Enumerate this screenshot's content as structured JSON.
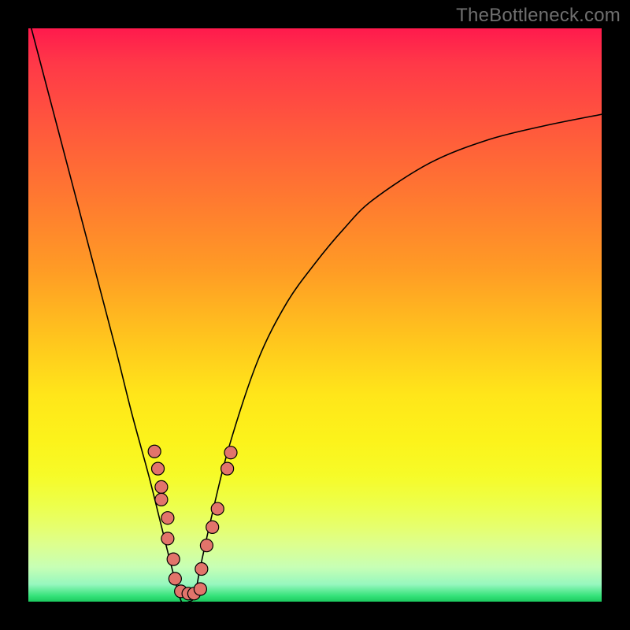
{
  "watermark": "TheBottleneck.com",
  "chart_data": {
    "type": "line",
    "title": "",
    "xlabel": "",
    "ylabel": "",
    "xlim": [
      0,
      1
    ],
    "ylim": [
      0,
      1
    ],
    "series": [
      {
        "name": "bottleneck-curve",
        "x": [
          0.0,
          0.05,
          0.1,
          0.15,
          0.18,
          0.21,
          0.23,
          0.25,
          0.267,
          0.28,
          0.29,
          0.3,
          0.32,
          0.35,
          0.4,
          0.45,
          0.5,
          0.55,
          0.6,
          0.7,
          0.8,
          0.9,
          1.0
        ],
        "y": [
          1.02,
          0.83,
          0.64,
          0.45,
          0.33,
          0.22,
          0.14,
          0.06,
          0.0,
          0.0,
          0.01,
          0.06,
          0.15,
          0.27,
          0.42,
          0.52,
          0.59,
          0.65,
          0.7,
          0.765,
          0.805,
          0.83,
          0.85
        ]
      }
    ],
    "markers": {
      "name": "data-point-markers",
      "points": [
        {
          "x": 0.22,
          "y": 0.262
        },
        {
          "x": 0.226,
          "y": 0.232
        },
        {
          "x": 0.232,
          "y": 0.2
        },
        {
          "x": 0.232,
          "y": 0.178
        },
        {
          "x": 0.243,
          "y": 0.146
        },
        {
          "x": 0.243,
          "y": 0.11
        },
        {
          "x": 0.253,
          "y": 0.074
        },
        {
          "x": 0.256,
          "y": 0.04
        },
        {
          "x": 0.266,
          "y": 0.018
        },
        {
          "x": 0.279,
          "y": 0.014
        },
        {
          "x": 0.289,
          "y": 0.014
        },
        {
          "x": 0.3,
          "y": 0.022
        },
        {
          "x": 0.302,
          "y": 0.057
        },
        {
          "x": 0.311,
          "y": 0.098
        },
        {
          "x": 0.321,
          "y": 0.13
        },
        {
          "x": 0.33,
          "y": 0.162
        },
        {
          "x": 0.347,
          "y": 0.232
        },
        {
          "x": 0.353,
          "y": 0.26
        }
      ],
      "radius_frac": 0.011,
      "fill": "#e2746b",
      "stroke": "#000000"
    },
    "gradient_stops": [
      {
        "pos": 0.0,
        "color": "#ff1a4d"
      },
      {
        "pos": 0.06,
        "color": "#ff3848"
      },
      {
        "pos": 0.18,
        "color": "#ff5a3c"
      },
      {
        "pos": 0.3,
        "color": "#ff7a30"
      },
      {
        "pos": 0.42,
        "color": "#ff9b25"
      },
      {
        "pos": 0.55,
        "color": "#ffc81d"
      },
      {
        "pos": 0.64,
        "color": "#ffe61a"
      },
      {
        "pos": 0.72,
        "color": "#fcf31b"
      },
      {
        "pos": 0.78,
        "color": "#f6fb28"
      },
      {
        "pos": 0.83,
        "color": "#edff4a"
      },
      {
        "pos": 0.87,
        "color": "#e6ff6e"
      },
      {
        "pos": 0.9,
        "color": "#ddff8e"
      },
      {
        "pos": 0.94,
        "color": "#c7ffb5"
      },
      {
        "pos": 0.97,
        "color": "#96f7be"
      },
      {
        "pos": 0.99,
        "color": "#35e27a"
      },
      {
        "pos": 1.0,
        "color": "#1bca5e"
      }
    ]
  }
}
